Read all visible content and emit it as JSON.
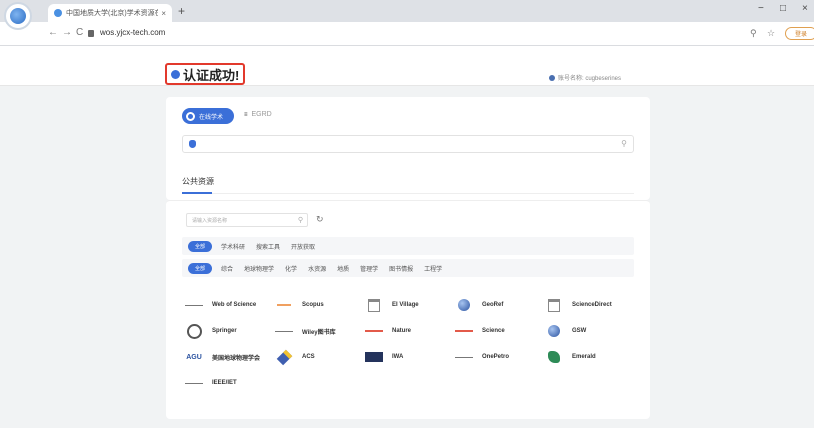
{
  "browser": {
    "tab_title": "中国地质大学(北京)学术资源在 ",
    "tab_close": "×",
    "new_tab": "+",
    "url": "wos.yjcx-tech.com",
    "signin": "登录",
    "controls": {
      "minimize": "−",
      "maximize": "□",
      "close": "×"
    },
    "nav": {
      "back": "←",
      "forward": "→",
      "reload": "C"
    },
    "addr_icons": {
      "zoom": "⚲",
      "star": "☆"
    }
  },
  "header": {
    "success_text": "认证成功!",
    "account_text": "账号名称: cugbeserines"
  },
  "search_mode": {
    "active": "在线学术",
    "other": "EGRD",
    "search_icon": "⚲"
  },
  "public_section": {
    "title": "公共资源",
    "search_placeholder": "请输入资源名称",
    "search_icon": "⚲",
    "refresh_icon": "↻",
    "type_filters": {
      "active": "全部",
      "items": [
        "学术科研",
        "搜索工具",
        "开放获取"
      ]
    },
    "subject_filters": {
      "active": "全部",
      "items": [
        "综合",
        "地球物理学",
        "化学",
        "水资源",
        "地质",
        "管理学",
        "图书情报",
        "工程学"
      ]
    }
  },
  "databases": [
    {
      "name": "Web of Science",
      "icon": "line"
    },
    {
      "name": "Scopus",
      "icon": "orange"
    },
    {
      "name": "EI Village",
      "icon": "box"
    },
    {
      "name": "GeoRef",
      "icon": "globe"
    },
    {
      "name": "ScienceDirect",
      "icon": "box"
    },
    {
      "name": "Springer",
      "icon": "springer"
    },
    {
      "name": "Wiley图书库",
      "icon": "line"
    },
    {
      "name": "Nature",
      "icon": "red"
    },
    {
      "name": "Science",
      "icon": "red"
    },
    {
      "name": "GSW",
      "icon": "globe"
    },
    {
      "name": "美国地球物理学会",
      "icon": "agu",
      "logo_text": "AGU"
    },
    {
      "name": "ACS",
      "icon": "dia"
    },
    {
      "name": "IWA",
      "icon": "iwa"
    },
    {
      "name": "OnePetro",
      "icon": "line"
    },
    {
      "name": "Emerald",
      "icon": "emer"
    },
    {
      "name": "IEEE/IET",
      "icon": "line"
    }
  ],
  "colors": {
    "accent": "#3b6fd8",
    "highlight_border": "#e2392c"
  }
}
